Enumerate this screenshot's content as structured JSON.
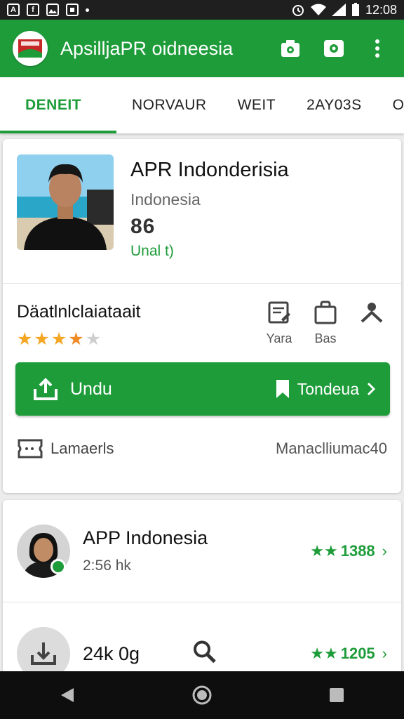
{
  "status_bar": {
    "time": "12:08",
    "left_icons": [
      "A",
      "f"
    ]
  },
  "app_bar": {
    "title": "ApsilljaPR oidneesia",
    "icons": [
      "camera-icon",
      "photo-icon",
      "more-vert-icon"
    ]
  },
  "tabs": [
    {
      "label": "DENEIT",
      "active": true
    },
    {
      "label": "NORVAUR",
      "active": false
    },
    {
      "label": "WEIT",
      "active": false
    },
    {
      "label": "2AY03S",
      "active": false
    },
    {
      "label": "OFE",
      "active": false
    }
  ],
  "profile": {
    "title": "APR Indonderisia",
    "subtitle": "Indonesia",
    "number": "86",
    "link": "Unal t)"
  },
  "detail": {
    "title": "Däatlnlclaiataait",
    "rating": 3.5,
    "rating_max": 5,
    "actions": [
      {
        "icon": "edit-document-icon",
        "label": "Yara"
      },
      {
        "icon": "bag-icon",
        "label": "Bas"
      },
      {
        "icon": "person-icon",
        "label": ""
      }
    ]
  },
  "primary_button": {
    "left_label": "Undu",
    "right_label": "Tondeua"
  },
  "footer": {
    "left_label": "Lamaerls",
    "right_label": "Manaclliumac40"
  },
  "list": [
    {
      "title": "APP Indonesia",
      "subtitle": "2:56 hk",
      "rating_text": "1388",
      "stars": 2
    },
    {
      "title": "24k 0g",
      "subtitle": "",
      "rating_text": "1205",
      "stars": 2
    }
  ],
  "colors": {
    "brand_green": "#1e9c3a",
    "star_gold": "#f5a623"
  }
}
